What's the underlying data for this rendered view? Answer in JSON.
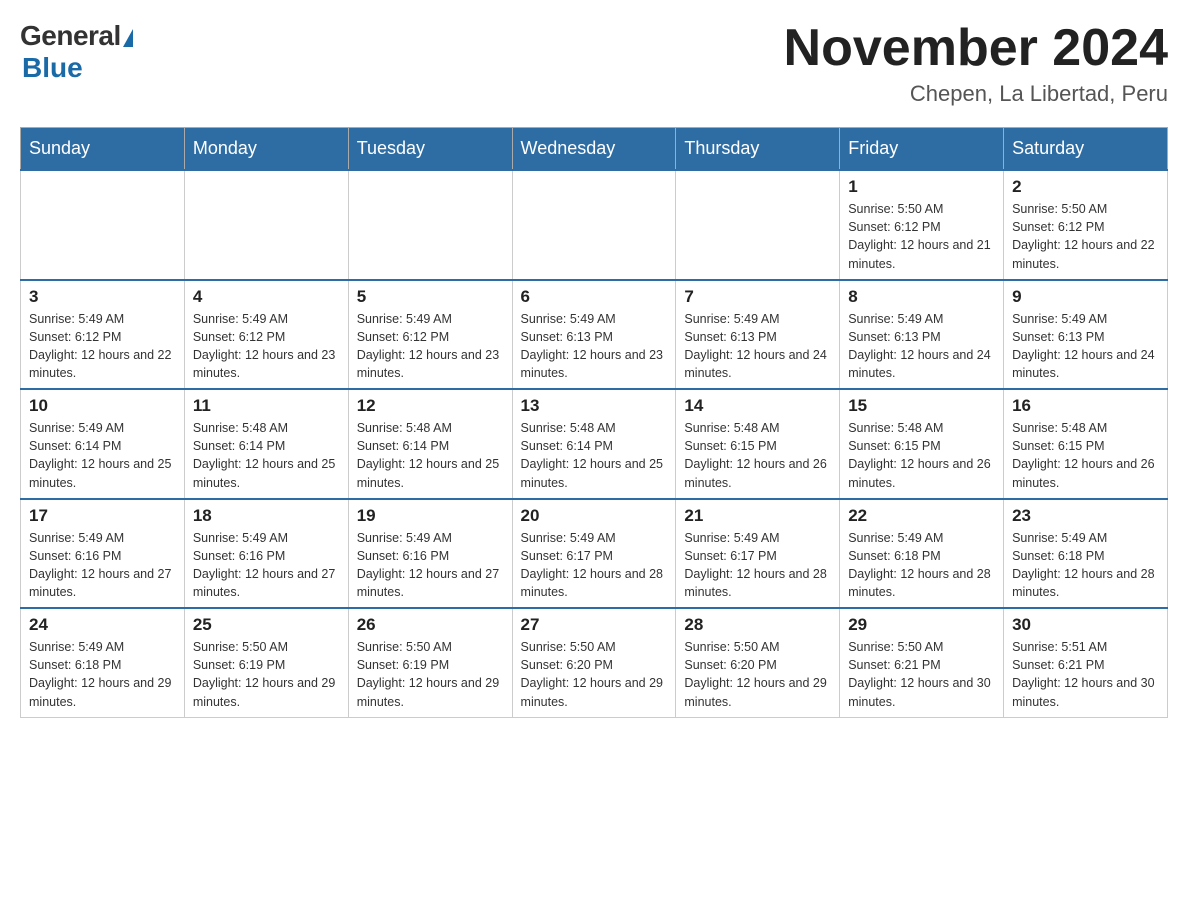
{
  "header": {
    "logo_general": "General",
    "logo_blue": "Blue",
    "month_title": "November 2024",
    "location": "Chepen, La Libertad, Peru"
  },
  "days_of_week": [
    "Sunday",
    "Monday",
    "Tuesday",
    "Wednesday",
    "Thursday",
    "Friday",
    "Saturday"
  ],
  "weeks": [
    [
      {
        "day": "",
        "sunrise": "",
        "sunset": "",
        "daylight": "",
        "empty": true
      },
      {
        "day": "",
        "sunrise": "",
        "sunset": "",
        "daylight": "",
        "empty": true
      },
      {
        "day": "",
        "sunrise": "",
        "sunset": "",
        "daylight": "",
        "empty": true
      },
      {
        "day": "",
        "sunrise": "",
        "sunset": "",
        "daylight": "",
        "empty": true
      },
      {
        "day": "",
        "sunrise": "",
        "sunset": "",
        "daylight": "",
        "empty": true
      },
      {
        "day": "1",
        "sunrise": "Sunrise: 5:50 AM",
        "sunset": "Sunset: 6:12 PM",
        "daylight": "Daylight: 12 hours and 21 minutes.",
        "empty": false
      },
      {
        "day": "2",
        "sunrise": "Sunrise: 5:50 AM",
        "sunset": "Sunset: 6:12 PM",
        "daylight": "Daylight: 12 hours and 22 minutes.",
        "empty": false
      }
    ],
    [
      {
        "day": "3",
        "sunrise": "Sunrise: 5:49 AM",
        "sunset": "Sunset: 6:12 PM",
        "daylight": "Daylight: 12 hours and 22 minutes.",
        "empty": false
      },
      {
        "day": "4",
        "sunrise": "Sunrise: 5:49 AM",
        "sunset": "Sunset: 6:12 PM",
        "daylight": "Daylight: 12 hours and 23 minutes.",
        "empty": false
      },
      {
        "day": "5",
        "sunrise": "Sunrise: 5:49 AM",
        "sunset": "Sunset: 6:12 PM",
        "daylight": "Daylight: 12 hours and 23 minutes.",
        "empty": false
      },
      {
        "day": "6",
        "sunrise": "Sunrise: 5:49 AM",
        "sunset": "Sunset: 6:13 PM",
        "daylight": "Daylight: 12 hours and 23 minutes.",
        "empty": false
      },
      {
        "day": "7",
        "sunrise": "Sunrise: 5:49 AM",
        "sunset": "Sunset: 6:13 PM",
        "daylight": "Daylight: 12 hours and 24 minutes.",
        "empty": false
      },
      {
        "day": "8",
        "sunrise": "Sunrise: 5:49 AM",
        "sunset": "Sunset: 6:13 PM",
        "daylight": "Daylight: 12 hours and 24 minutes.",
        "empty": false
      },
      {
        "day": "9",
        "sunrise": "Sunrise: 5:49 AM",
        "sunset": "Sunset: 6:13 PM",
        "daylight": "Daylight: 12 hours and 24 minutes.",
        "empty": false
      }
    ],
    [
      {
        "day": "10",
        "sunrise": "Sunrise: 5:49 AM",
        "sunset": "Sunset: 6:14 PM",
        "daylight": "Daylight: 12 hours and 25 minutes.",
        "empty": false
      },
      {
        "day": "11",
        "sunrise": "Sunrise: 5:48 AM",
        "sunset": "Sunset: 6:14 PM",
        "daylight": "Daylight: 12 hours and 25 minutes.",
        "empty": false
      },
      {
        "day": "12",
        "sunrise": "Sunrise: 5:48 AM",
        "sunset": "Sunset: 6:14 PM",
        "daylight": "Daylight: 12 hours and 25 minutes.",
        "empty": false
      },
      {
        "day": "13",
        "sunrise": "Sunrise: 5:48 AM",
        "sunset": "Sunset: 6:14 PM",
        "daylight": "Daylight: 12 hours and 25 minutes.",
        "empty": false
      },
      {
        "day": "14",
        "sunrise": "Sunrise: 5:48 AM",
        "sunset": "Sunset: 6:15 PM",
        "daylight": "Daylight: 12 hours and 26 minutes.",
        "empty": false
      },
      {
        "day": "15",
        "sunrise": "Sunrise: 5:48 AM",
        "sunset": "Sunset: 6:15 PM",
        "daylight": "Daylight: 12 hours and 26 minutes.",
        "empty": false
      },
      {
        "day": "16",
        "sunrise": "Sunrise: 5:48 AM",
        "sunset": "Sunset: 6:15 PM",
        "daylight": "Daylight: 12 hours and 26 minutes.",
        "empty": false
      }
    ],
    [
      {
        "day": "17",
        "sunrise": "Sunrise: 5:49 AM",
        "sunset": "Sunset: 6:16 PM",
        "daylight": "Daylight: 12 hours and 27 minutes.",
        "empty": false
      },
      {
        "day": "18",
        "sunrise": "Sunrise: 5:49 AM",
        "sunset": "Sunset: 6:16 PM",
        "daylight": "Daylight: 12 hours and 27 minutes.",
        "empty": false
      },
      {
        "day": "19",
        "sunrise": "Sunrise: 5:49 AM",
        "sunset": "Sunset: 6:16 PM",
        "daylight": "Daylight: 12 hours and 27 minutes.",
        "empty": false
      },
      {
        "day": "20",
        "sunrise": "Sunrise: 5:49 AM",
        "sunset": "Sunset: 6:17 PM",
        "daylight": "Daylight: 12 hours and 28 minutes.",
        "empty": false
      },
      {
        "day": "21",
        "sunrise": "Sunrise: 5:49 AM",
        "sunset": "Sunset: 6:17 PM",
        "daylight": "Daylight: 12 hours and 28 minutes.",
        "empty": false
      },
      {
        "day": "22",
        "sunrise": "Sunrise: 5:49 AM",
        "sunset": "Sunset: 6:18 PM",
        "daylight": "Daylight: 12 hours and 28 minutes.",
        "empty": false
      },
      {
        "day": "23",
        "sunrise": "Sunrise: 5:49 AM",
        "sunset": "Sunset: 6:18 PM",
        "daylight": "Daylight: 12 hours and 28 minutes.",
        "empty": false
      }
    ],
    [
      {
        "day": "24",
        "sunrise": "Sunrise: 5:49 AM",
        "sunset": "Sunset: 6:18 PM",
        "daylight": "Daylight: 12 hours and 29 minutes.",
        "empty": false
      },
      {
        "day": "25",
        "sunrise": "Sunrise: 5:50 AM",
        "sunset": "Sunset: 6:19 PM",
        "daylight": "Daylight: 12 hours and 29 minutes.",
        "empty": false
      },
      {
        "day": "26",
        "sunrise": "Sunrise: 5:50 AM",
        "sunset": "Sunset: 6:19 PM",
        "daylight": "Daylight: 12 hours and 29 minutes.",
        "empty": false
      },
      {
        "day": "27",
        "sunrise": "Sunrise: 5:50 AM",
        "sunset": "Sunset: 6:20 PM",
        "daylight": "Daylight: 12 hours and 29 minutes.",
        "empty": false
      },
      {
        "day": "28",
        "sunrise": "Sunrise: 5:50 AM",
        "sunset": "Sunset: 6:20 PM",
        "daylight": "Daylight: 12 hours and 29 minutes.",
        "empty": false
      },
      {
        "day": "29",
        "sunrise": "Sunrise: 5:50 AM",
        "sunset": "Sunset: 6:21 PM",
        "daylight": "Daylight: 12 hours and 30 minutes.",
        "empty": false
      },
      {
        "day": "30",
        "sunrise": "Sunrise: 5:51 AM",
        "sunset": "Sunset: 6:21 PM",
        "daylight": "Daylight: 12 hours and 30 minutes.",
        "empty": false
      }
    ]
  ]
}
